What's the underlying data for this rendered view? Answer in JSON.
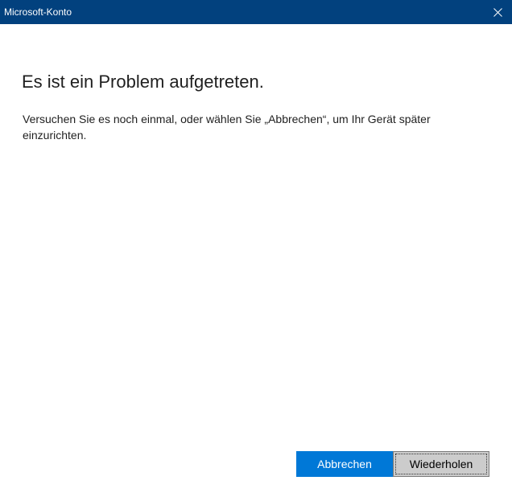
{
  "window": {
    "title": "Microsoft-Konto",
    "close_icon": "close-icon"
  },
  "dialog": {
    "heading": "Es ist ein Problem aufgetreten.",
    "message": "Versuchen Sie es noch einmal, oder wählen Sie „Abbrechen“, um Ihr Gerät später einzurichten."
  },
  "buttons": {
    "cancel_label": "Abbrechen",
    "retry_label": "Wiederholen"
  },
  "colors": {
    "titlebar": "#02417e",
    "accent": "#0078d7",
    "secondary_button": "#cccccc"
  }
}
